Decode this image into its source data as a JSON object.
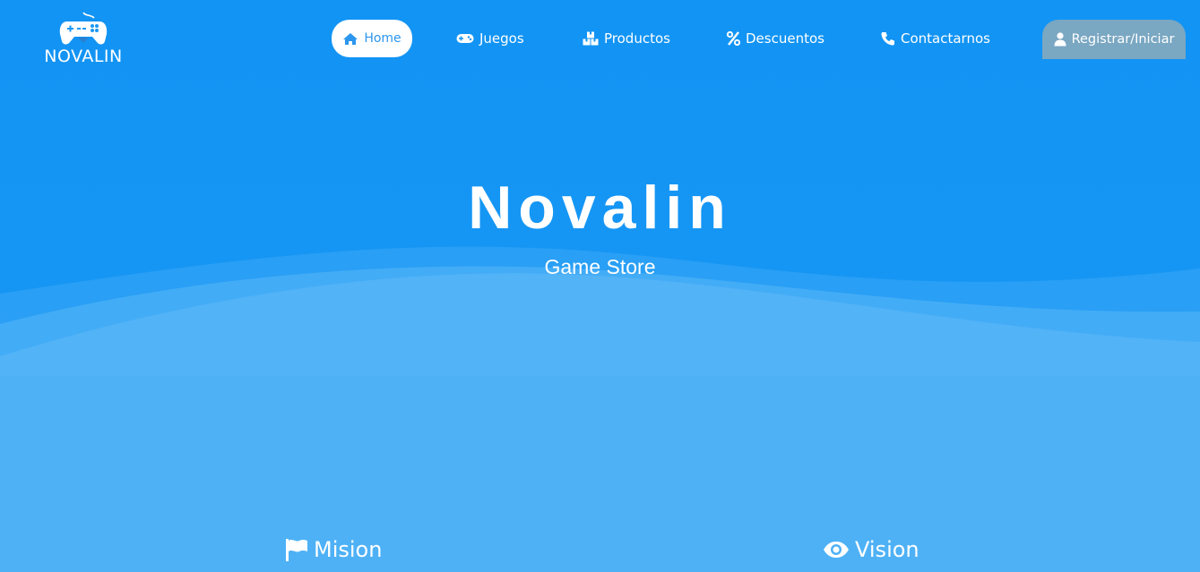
{
  "brand": {
    "logo_text": "NOVALIN",
    "logo_icon": "gamepad-icon"
  },
  "nav": {
    "items": [
      {
        "label": "Home",
        "icon": "home-icon",
        "active": true
      },
      {
        "label": "Juegos",
        "icon": "gamepad-icon"
      },
      {
        "label": "Productos",
        "icon": "boxes-icon"
      },
      {
        "label": "Descuentos",
        "icon": "percent-icon"
      },
      {
        "label": "Contactarnos",
        "icon": "phone-icon"
      }
    ],
    "register_label": "Registrar/Iniciar",
    "register_icon": "user-icon"
  },
  "hero": {
    "title": "Novalin",
    "subtitle": "Game Store"
  },
  "sections": {
    "mision": {
      "label": "Mision",
      "icon": "flag-icon"
    },
    "vision": {
      "label": "Vision",
      "icon": "eye-icon"
    }
  },
  "colors": {
    "hero_top": "#1094f4",
    "hero_bottom": "#4eb1f6",
    "wave_light": "#56b4f7",
    "nav_active_bg": "#ffffff",
    "nav_active_text": "#2b96ee",
    "register_bg": "#7aa7c2",
    "text": "#ffffff"
  }
}
